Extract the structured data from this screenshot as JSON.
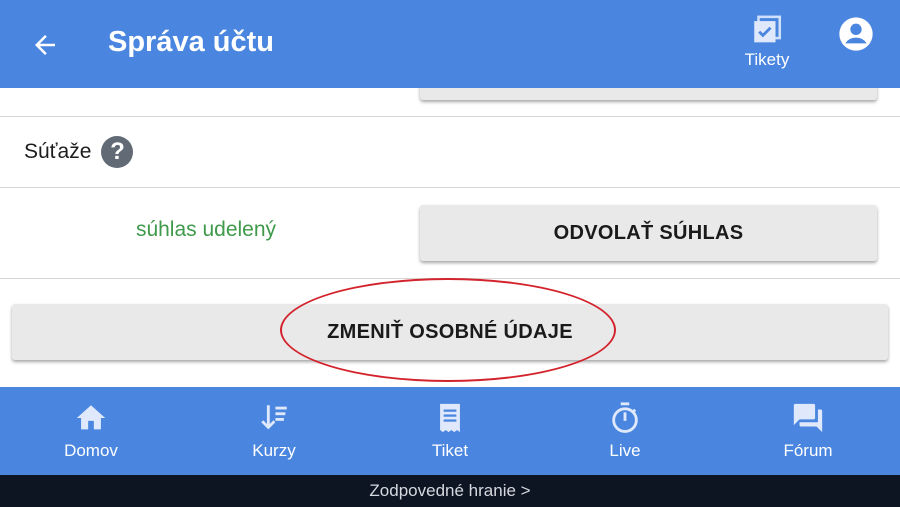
{
  "appbar": {
    "title": "Správa účtu",
    "tikety_label": "Tikety"
  },
  "content": {
    "contest_label": "Súťaže",
    "help_glyph": "?",
    "consent_status": "súhlas udelený",
    "revoke_button": "ODVOLAŤ SÚHLAS",
    "change_button": "ZMENIŤ OSOBNÉ ÚDAJE"
  },
  "bottom_nav": {
    "items": [
      {
        "label": "Domov",
        "icon": "home-icon"
      },
      {
        "label": "Kurzy",
        "icon": "sort-icon"
      },
      {
        "label": "Tiket",
        "icon": "receipt-icon"
      },
      {
        "label": "Live",
        "icon": "stopwatch-icon"
      },
      {
        "label": "Fórum",
        "icon": "forum-icon"
      }
    ]
  },
  "footer": {
    "text": "Zodpovedné hranie >"
  },
  "colors": {
    "primary": "#4a86df",
    "button_bg": "#e9e9e9",
    "status_green": "#3f9a4b",
    "highlight_red": "#d3242d",
    "footer_bg": "#0d1522"
  }
}
